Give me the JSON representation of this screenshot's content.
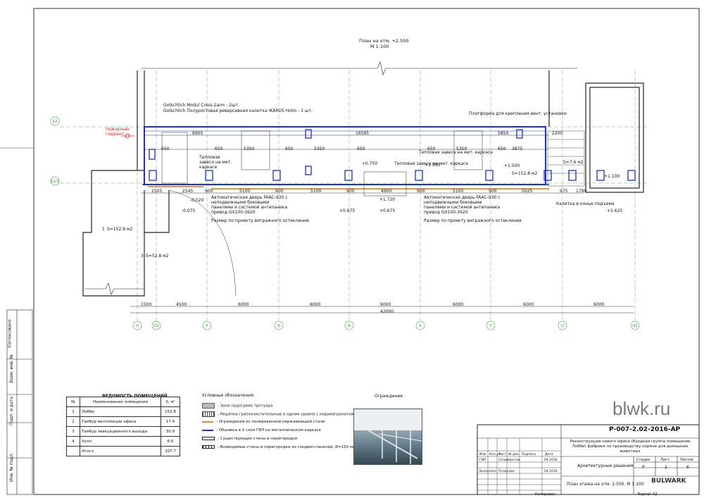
{
  "plan_title": "План на отм. +2.500",
  "plan_scale": "М 1:100",
  "notes": {
    "gotschlich1": "Gotschlich Modul Cross 2arm - 2шт.",
    "gotschlich2": "Gotschlich Полуростовая реверсивная калитка IKARUS Holm - 1 шт.",
    "platform": "Платформа для крепления вент. установки",
    "fire_alarm": "пожарный гидрант",
    "curtain1": "Тепловая завеса на мет. каркасе",
    "curtain2": "Тепловая завеса на мет. каркасе",
    "curtain3": "Тепловая завеса на мет. каркасе",
    "door1": "Автоматическая дверь FAAC-930 с неподвижными боковыми панелями и системой антипаника привод GX100-3620",
    "door1_note": "Размер по проекту витражного остекления.",
    "door2": "Автоматическая дверь FAAC-930 с неподвижными боковыми панелями и системой антипаника привод GX100-3620",
    "door2_note": "Размер по проекту витражного остекления.",
    "lift_note": "Калитка в конце подъема",
    "area1": "S=152.8 м2",
    "area1_marker": "1",
    "area3": "S=52.8 м2",
    "area3_marker": "3",
    "area4": "S=7.6 м2",
    "area_main": "S=152.8 м2"
  },
  "dims": {
    "top_row": [
      "8905",
      "16595",
      "5850",
      "2200"
    ],
    "second_row": [
      "650",
      "650",
      "5350",
      "650",
      "5350",
      "650",
      "650",
      "5350",
      "650",
      "3875"
    ],
    "bottom_row": [
      "2505",
      "2545",
      "900",
      "5100",
      "900",
      "5100",
      "900",
      "4900",
      "900",
      "5100",
      "900",
      "5025",
      "975",
      "1790"
    ],
    "total_row": [
      "1500",
      "4500",
      "6000",
      "6000",
      "6000",
      "6000",
      "6000",
      "6000"
    ],
    "total": "42000",
    "levels": [
      "+1.500",
      "+1.500",
      "+1.100",
      "+1.625",
      "+0.750",
      "+0.675",
      "-0.075",
      "-0.020",
      "+1.720",
      "+0.675"
    ]
  },
  "axes": [
    "О",
    "О1",
    "Р",
    "Q",
    "R",
    "S",
    "T",
    "U",
    "U1"
  ],
  "row_axes": [
    "12",
    "11/1"
  ],
  "side_strip": [
    "Согласовано",
    "Взам. инв. №",
    "Подп. и дата",
    "Инв. № подл."
  ],
  "rooms_table": {
    "title": "ВЕДОМОСТЬ ПОМЕЩЕНИЙ",
    "headers": [
      "№",
      "Наименование помещения",
      "S, м²"
    ],
    "rows": [
      [
        "1",
        "Лобби",
        "152.8"
      ],
      [
        "2",
        "Тамбур вентиляции офиса",
        "17.4"
      ],
      [
        "3",
        "Тамбур эвакуационного выхода",
        "30.9"
      ],
      [
        "4",
        "Холл",
        "6.6"
      ],
      [
        "",
        "Итого",
        "207.7"
      ]
    ]
  },
  "legend": {
    "title": "Условные обозначения:",
    "items": [
      "- Зона подогрева тротуара",
      "- Решетки грязеочистительные в одном уровне с керамогранитом",
      "- Ограждения из полированной нержавеющей стали",
      "- Обшивка в 2 слоя ГВЛ на металлическом каркасе",
      "- Существующие стены и перегородки",
      "- Возводимые стены и перегородки из сэндвич-панелей, В=150 мм"
    ]
  },
  "photo_title": "Ограждение",
  "stamp": {
    "code": "Р-007-2.02-2016-АР",
    "description": "Реконструкция нового офиса (Входная группа помещение Лобби) фабрики по производству кормов для домашних животных",
    "section": "Архитектурные решения",
    "sheet_title": "План этажа на отм. 2.500. М 1:100",
    "stage_h": "Стадия",
    "sheet_h": "Лист",
    "sheets_h": "Листов",
    "stage": "Р",
    "sheet": "2",
    "sheets": "6",
    "col_heads": [
      "Изм.",
      "Кол.уч",
      "Лист",
      "№ док.",
      "Подпись",
      "Дата"
    ],
    "role1": "ГИП",
    "name1": "Селивёрстов",
    "date1": "04.2016",
    "role2": "Выполнил",
    "name2": "Позднова",
    "date2": "04.2016",
    "copied": "Копировал",
    "format": "Формат А2",
    "company": "BULWARK"
  },
  "watermark": "blwk.ru"
}
